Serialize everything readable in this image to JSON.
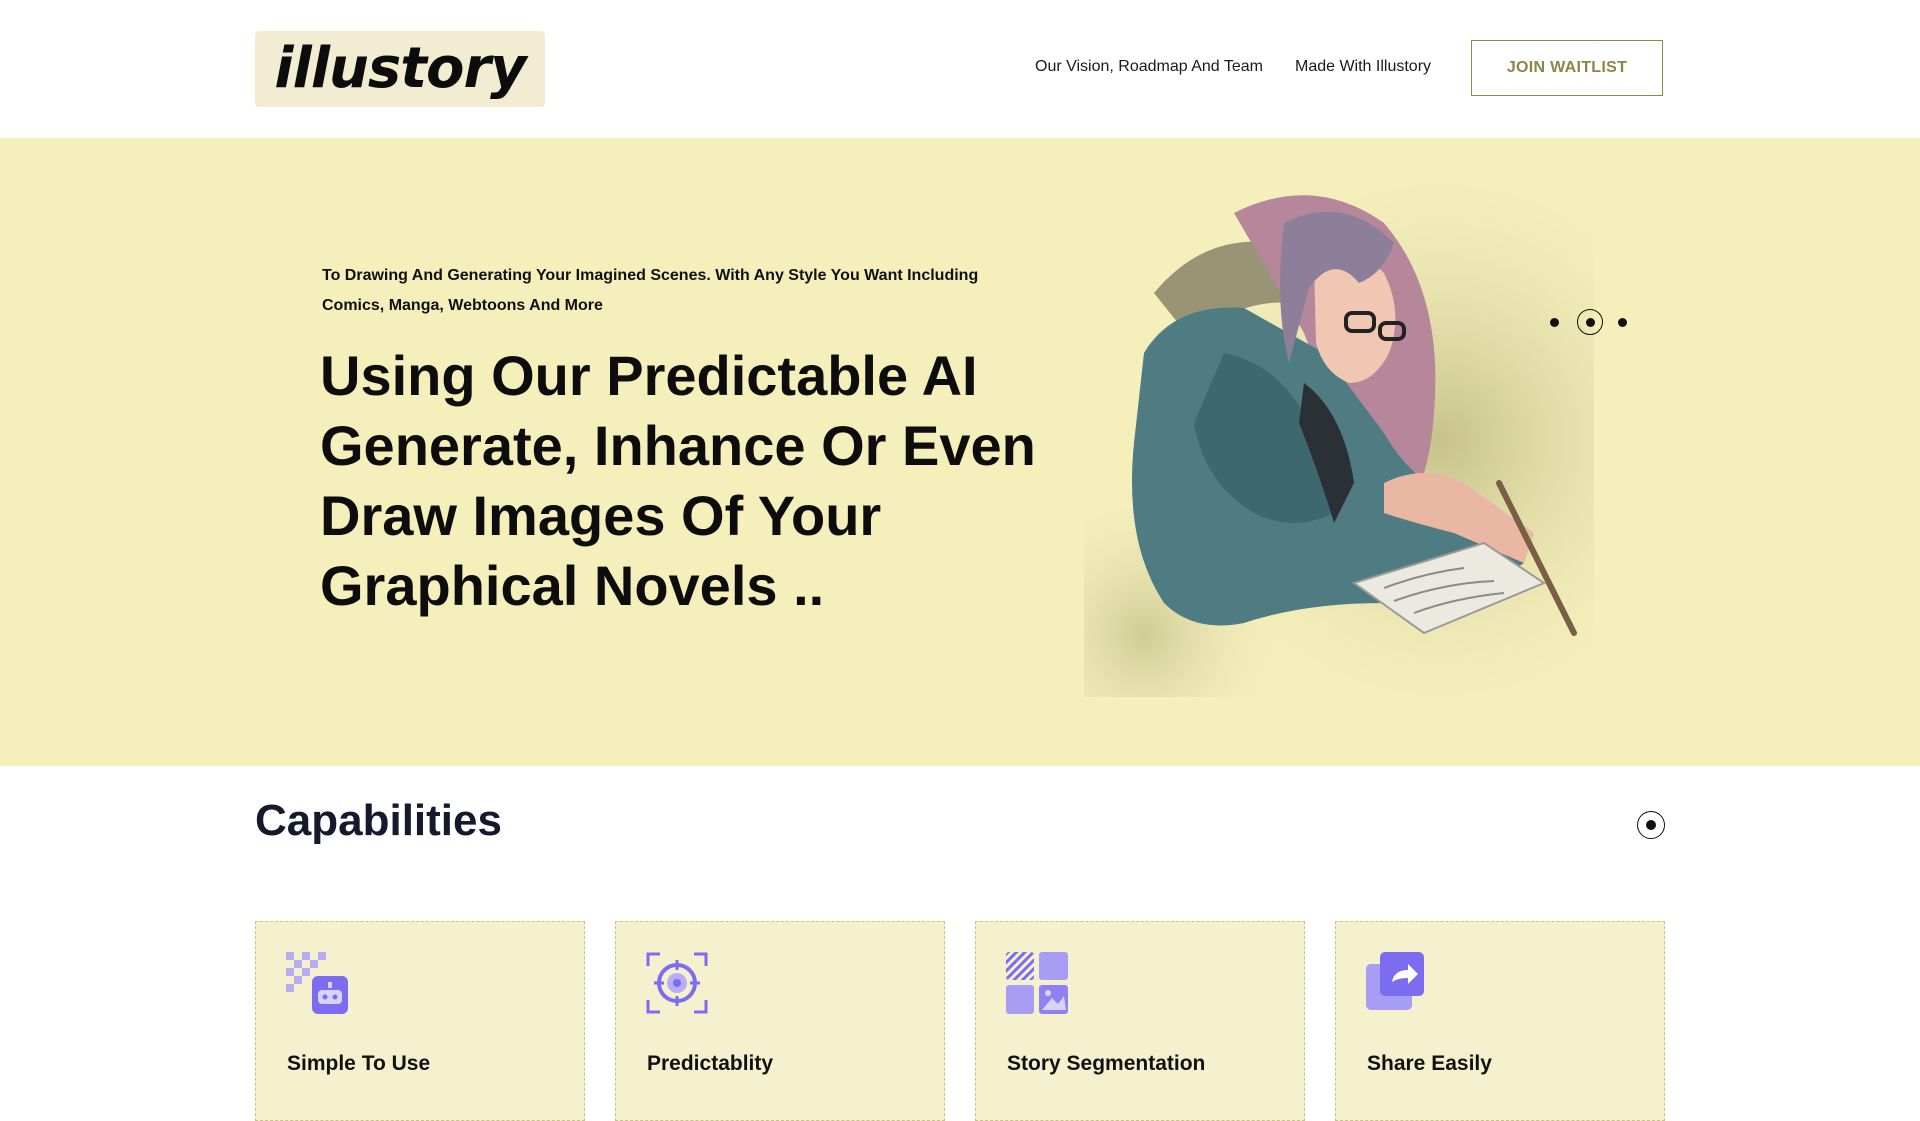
{
  "brand": {
    "logo_text": "illustory"
  },
  "nav": {
    "items": [
      "Our Vision, Roadmap And Team",
      "Made With Illustory"
    ],
    "cta_label": "JOIN WAITLIST"
  },
  "hero": {
    "kicker": "To Drawing And Generating Your Imagined Scenes. With Any Style You Want Including Comics, Manga, Webtoons And More",
    "title": "Using Our Predictable AI Generate, Inhance Or Even Draw Images Of Your Graphical Novels ..",
    "carousel": {
      "total": 3,
      "active": 2
    }
  },
  "capabilities": {
    "title": "Capabilities",
    "cards": [
      {
        "label": "Simple To Use",
        "icon": "robot-grid-icon"
      },
      {
        "label": "Predictablity",
        "icon": "target-icon"
      },
      {
        "label": "Story Segmentation",
        "icon": "segments-icon"
      },
      {
        "label": "Share Easily",
        "icon": "share-icon"
      }
    ]
  },
  "colors": {
    "hero_bg": "#f4efbb",
    "card_bg": "#f5f1cf",
    "accent_text": "#8b8648",
    "icon_purple": "#7b6cf0"
  }
}
